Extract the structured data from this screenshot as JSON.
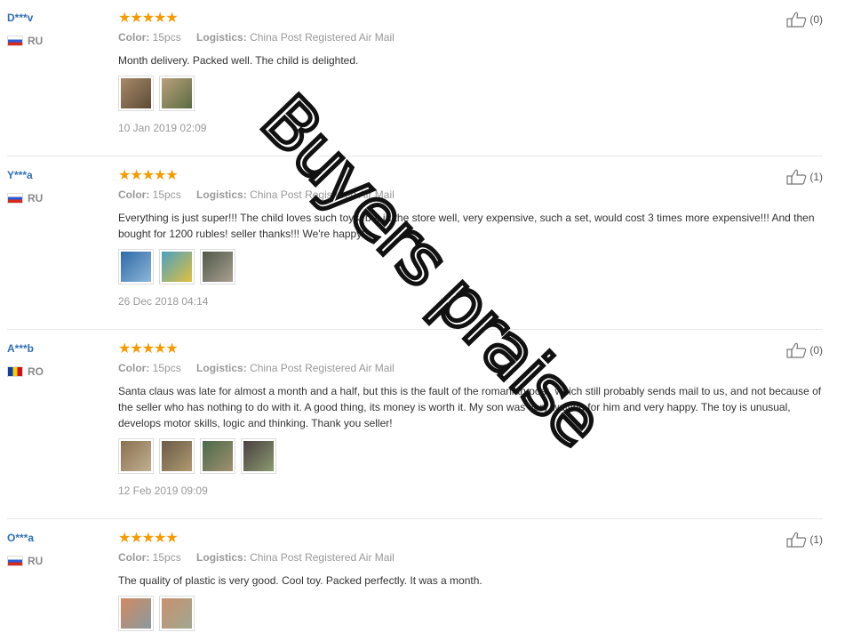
{
  "reviews": [
    {
      "user": "D***v",
      "country": "RU",
      "flag": "ru",
      "stars": "★★★★★",
      "color_label": "Color:",
      "color_value": "15pcs",
      "logistics_label": "Logistics:",
      "logistics_value": "China Post Registered Air Mail",
      "text": "Month delivery. Packed well. The child is delighted.",
      "date": "10 Jan 2019 02:09",
      "helpful_count": "(0)",
      "photos": [
        "#8a6a4c",
        "#7b7f5d"
      ]
    },
    {
      "user": "Y***a",
      "country": "RU",
      "flag": "ru",
      "stars": "★★★★★",
      "color_label": "Color:",
      "color_value": "15pcs",
      "logistics_label": "Logistics:",
      "logistics_value": "China Post Registered Air Mail",
      "text": "Everything is just super!!! The child loves such toys, but in the store well, very expensive, such a set, would cost 3 times more expensive!!! And then bought for 1200 rubles! seller thanks!!! We're happy!",
      "date": "26 Dec 2018 04:14",
      "helpful_count": "(1)",
      "photos": [
        "#4c84b8",
        "#5fa0a8",
        "#6d6e5a"
      ]
    },
    {
      "user": "A***b",
      "country": "RO",
      "flag": "ro",
      "stars": "★★★★★",
      "color_label": "Color:",
      "color_value": "15pcs",
      "logistics_label": "Logistics:",
      "logistics_value": "China Post Registered Air Mail",
      "text": "Santa claus was late for almost a month and a half, but this is the fault of the romanian post, which still probably sends mail to us, and not because of the seller who has nothing to do with it. A good thing, its money is worth it. My son was very waiting for him and very happy. The toy is unusual, develops motor skills, logic and thinking. Thank you seller!",
      "date": "12 Feb 2019 09:09",
      "helpful_count": "(0)",
      "photos": [
        "#8c7a5a",
        "#7a6a50",
        "#6a7a5a",
        "#5e5a52"
      ]
    },
    {
      "user": "O***a",
      "country": "RU",
      "flag": "ru",
      "stars": "★★★★★",
      "color_label": "Color:",
      "color_value": "15pcs",
      "logistics_label": "Logistics:",
      "logistics_value": "China Post Registered Air Mail",
      "text": "The quality of plastic is very good. Cool toy. Packed perfectly. It was a month.",
      "date": "",
      "helpful_count": "(1)",
      "photos": [
        "#c07e58",
        "#b88d66"
      ]
    }
  ],
  "watermark": "Buyers praise"
}
